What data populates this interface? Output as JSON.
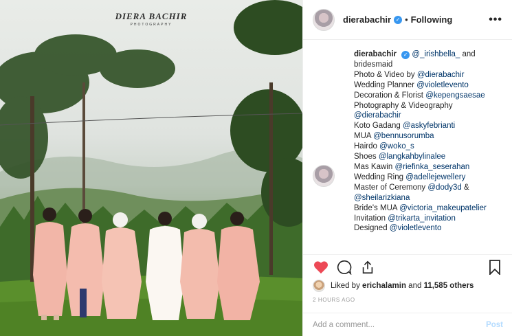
{
  "photo": {
    "watermark_main": "DIERA BACHIR",
    "watermark_sub": "PHOTOGRAPHY"
  },
  "header": {
    "username": "dierabachir",
    "verified_icon": "verified-badge-icon",
    "separator": "•",
    "follow_status": "Following",
    "more": "•••"
  },
  "caption": {
    "username": "dierabachir",
    "lines": [
      {
        "text": "",
        "link": "@_irishbella_",
        "after": " and"
      },
      {
        "text": "bridesmaid",
        "link": "",
        "after": ""
      },
      {
        "text": "Photo & Video by ",
        "link": "@dierabachir",
        "after": ""
      },
      {
        "text": "Wedding Planner ",
        "link": "@violetlevento",
        "after": ""
      },
      {
        "text": "Decoration & Florist ",
        "link": "@kepengsaesae",
        "after": ""
      },
      {
        "text": "Photography & Videography",
        "link": "",
        "after": ""
      },
      {
        "text": "",
        "link": "@dierabachir",
        "after": ""
      },
      {
        "text": "Koto Gadang ",
        "link": "@askyfebrianti",
        "after": ""
      },
      {
        "text": "MUA ",
        "link": "@bennusorumba",
        "after": ""
      },
      {
        "text": "Hairdo ",
        "link": "@woko_s",
        "after": ""
      },
      {
        "text": "Shoes ",
        "link": "@langkahbylinalee",
        "after": ""
      },
      {
        "text": "Mas Kawin ",
        "link": "@riefinka_seserahan",
        "after": ""
      },
      {
        "text": "Wedding Ring ",
        "link": "@adellejewellery",
        "after": ""
      },
      {
        "text": "Master of Ceremony ",
        "link": "@dody3d",
        "after": " &"
      },
      {
        "text": "",
        "link": "@sheilarizkiana",
        "after": ""
      },
      {
        "text": "Bride's MUA ",
        "link": "@victoria_makeupatelier",
        "after": ""
      },
      {
        "text": "Invitation ",
        "link": "@trikarta_invitation",
        "after": ""
      },
      {
        "text": "Designed ",
        "link": "@violetlevento",
        "after": ""
      }
    ]
  },
  "actions": {
    "like_icon": "heart-filled-icon",
    "comment_icon": "comment-bubble-icon",
    "share_icon": "share-icon",
    "save_icon": "bookmark-icon",
    "like_color": "#ed4956"
  },
  "likes": {
    "prefix": "Liked by ",
    "user": "erichalamin",
    "middle": " and ",
    "others": "11,585 others"
  },
  "timestamp": "2 HOURS AGO",
  "comment": {
    "placeholder": "Add a comment...",
    "post_label": "Post"
  }
}
